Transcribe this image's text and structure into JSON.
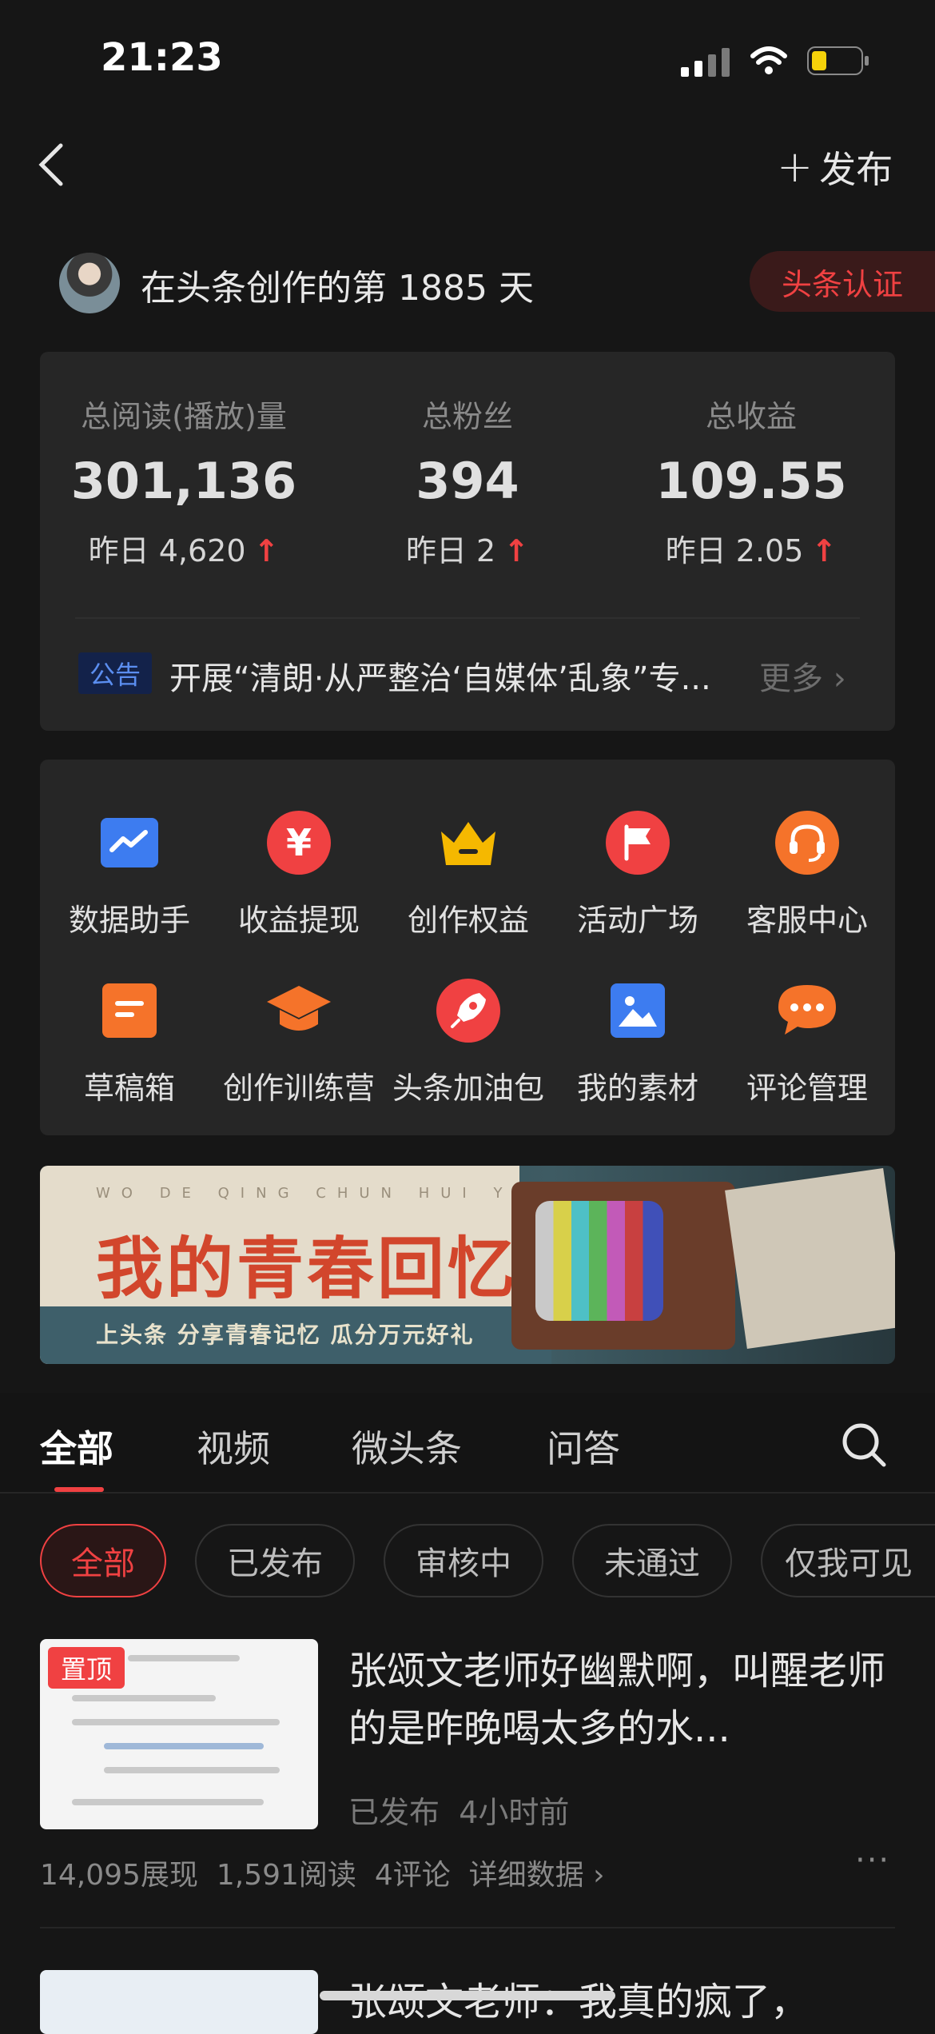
{
  "status": {
    "time": "21:23"
  },
  "nav": {
    "publish_label": "发布"
  },
  "creator": {
    "text": "在头条创作的第 1885 天",
    "badge": "头条认证"
  },
  "stats": [
    {
      "label": "总阅读(播放)量",
      "value": "301,136",
      "delta": "昨日 4,620"
    },
    {
      "label": "总粉丝",
      "value": "394",
      "delta": "昨日 2"
    },
    {
      "label": "总收益",
      "value": "109.55",
      "delta": "昨日 2.05"
    }
  ],
  "notice": {
    "tag": "公告",
    "text": "开展“清朗·从严整治‘自媒体’乱象”专...",
    "more": "更多"
  },
  "tools": [
    {
      "label": "数据助手",
      "icon": "data-chart-icon",
      "color": "#3d7cf0"
    },
    {
      "label": "收益提现",
      "icon": "yuan-icon",
      "color": "#f04142"
    },
    {
      "label": "创作权益",
      "icon": "crown-icon",
      "color": "#f5b800"
    },
    {
      "label": "活动广场",
      "icon": "flag-icon",
      "color": "#f04142"
    },
    {
      "label": "客服中心",
      "icon": "headset-icon",
      "color": "#f5732a"
    },
    {
      "label": "草稿箱",
      "icon": "draft-icon",
      "color": "#f5732a"
    },
    {
      "label": "创作训练营",
      "icon": "graduation-cap-icon",
      "color": "#f5732a"
    },
    {
      "label": "头条加油包",
      "icon": "rocket-icon",
      "color": "#f04142"
    },
    {
      "label": "我的素材",
      "icon": "image-icon",
      "color": "#3d7cf0"
    },
    {
      "label": "评论管理",
      "icon": "comment-icon",
      "color": "#f5732a"
    }
  ],
  "banner": {
    "title": "我的青春回忆录",
    "subtitle": "上头条 分享青春记忆 瓜分万元好礼",
    "pinyin": "WO DE QING CHUN HUI YI LU"
  },
  "tabs": [
    "全部",
    "视频",
    "微头条",
    "问答"
  ],
  "filters": [
    "全部",
    "已发布",
    "审核中",
    "未通过",
    "仅我可见"
  ],
  "article": {
    "pin": "置顶",
    "title": "张颂文老师好幽默啊，叫醒老师的是昨晚喝太多的水...",
    "status": "已发布",
    "time": "4小时前",
    "impressions": "14,095展现",
    "reads": "1,591阅读",
    "comments": "4评论",
    "detail": "详细数据",
    "more": "···"
  },
  "article2": {
    "title": "张颂文老师：我真的疯了，"
  }
}
